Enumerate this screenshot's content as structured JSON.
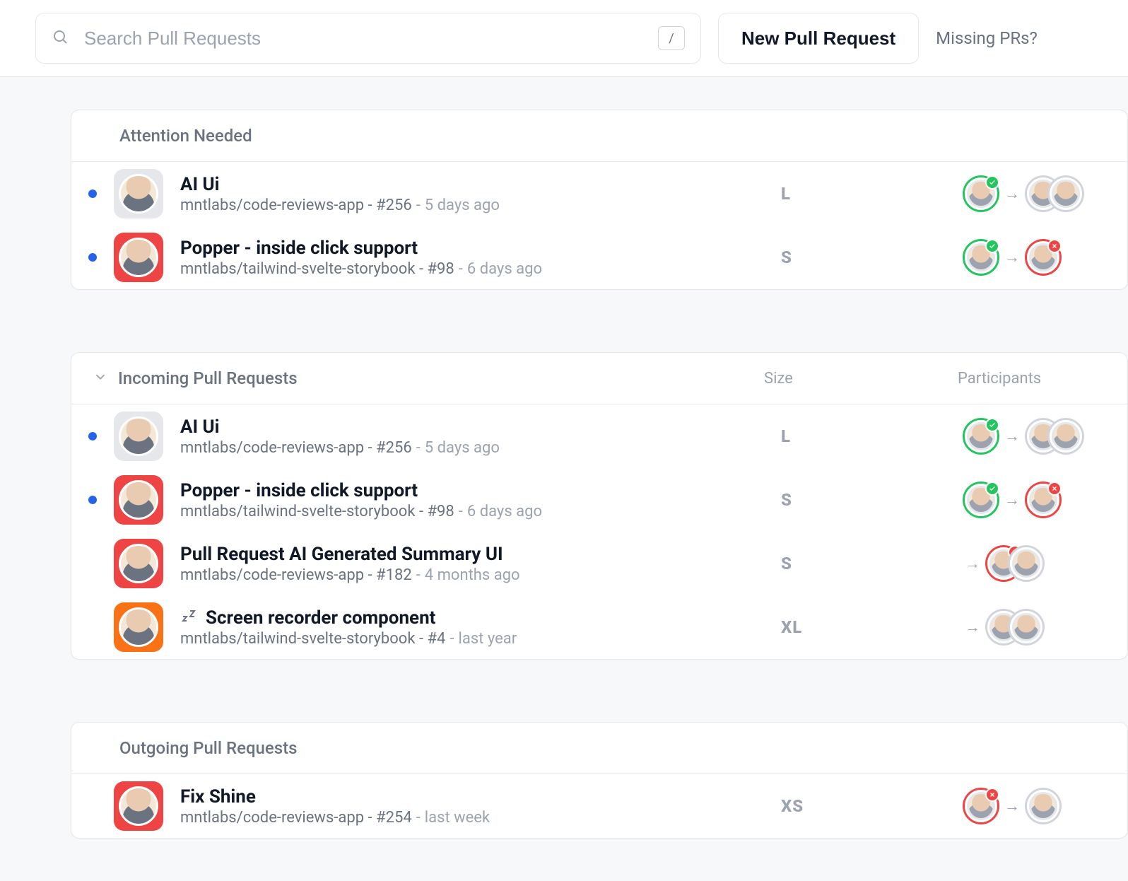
{
  "topbar": {
    "search_placeholder": "Search Pull Requests",
    "slash_key": "/",
    "new_pr_label": "New Pull Request",
    "missing_label": "Missing PRs?"
  },
  "sections": {
    "attention": {
      "title": "Attention Needed"
    },
    "incoming": {
      "title": "Incoming Pull Requests",
      "size_col": "Size",
      "participants_col": "Participants"
    },
    "outgoing": {
      "title": "Outgoing Pull Requests"
    }
  },
  "prs": {
    "attention": [
      {
        "title": "AI Ui",
        "repo": "mntlabs/code-reviews-app",
        "number": "#256",
        "time": "5 days ago",
        "size": "L",
        "unread": true,
        "repo_color": "gray",
        "author_status": "ok",
        "reviewers": [
          {
            "ring": "gray"
          },
          {
            "ring": "gray"
          }
        ]
      },
      {
        "title": "Popper - inside click support",
        "repo": "mntlabs/tailwind-svelte-storybook",
        "number": "#98",
        "time": "6 days ago",
        "size": "S",
        "unread": true,
        "repo_color": "red",
        "author_status": "ok",
        "reviewers": [
          {
            "ring": "red",
            "badge": "no"
          }
        ]
      }
    ],
    "incoming": [
      {
        "title": "AI Ui",
        "repo": "mntlabs/code-reviews-app",
        "number": "#256",
        "time": "5 days ago",
        "size": "L",
        "unread": true,
        "repo_color": "gray",
        "author_status": "ok",
        "reviewers": [
          {
            "ring": "gray"
          },
          {
            "ring": "gray"
          }
        ]
      },
      {
        "title": "Popper - inside click support",
        "repo": "mntlabs/tailwind-svelte-storybook",
        "number": "#98",
        "time": "6 days ago",
        "size": "S",
        "unread": true,
        "repo_color": "red",
        "author_status": "ok",
        "reviewers": [
          {
            "ring": "red",
            "badge": "no"
          }
        ]
      },
      {
        "title": "Pull Request AI Generated Summary UI",
        "repo": "mntlabs/code-reviews-app",
        "number": "#182",
        "time": "4 months ago",
        "size": "S",
        "unread": false,
        "repo_color": "red",
        "reviewers_leading_arrow": true,
        "reviewers": [
          {
            "ring": "red",
            "badge": "no"
          },
          {
            "ring": "gray"
          }
        ]
      },
      {
        "title": "Screen recorder component",
        "repo": "mntlabs/tailwind-svelte-storybook",
        "number": "#4",
        "time": "last year",
        "size": "XL",
        "unread": false,
        "sleeping": true,
        "repo_color": "orange",
        "reviewers_leading_arrow": true,
        "reviewers": [
          {
            "ring": "gray"
          },
          {
            "ring": "gray"
          }
        ]
      }
    ],
    "outgoing": [
      {
        "title": "Fix Shine",
        "repo": "mntlabs/code-reviews-app",
        "number": "#254",
        "time": "last week",
        "size": "XS",
        "unread": false,
        "repo_color": "red",
        "author_status": "no",
        "reviewers": [
          {
            "ring": "gray"
          }
        ]
      }
    ]
  }
}
